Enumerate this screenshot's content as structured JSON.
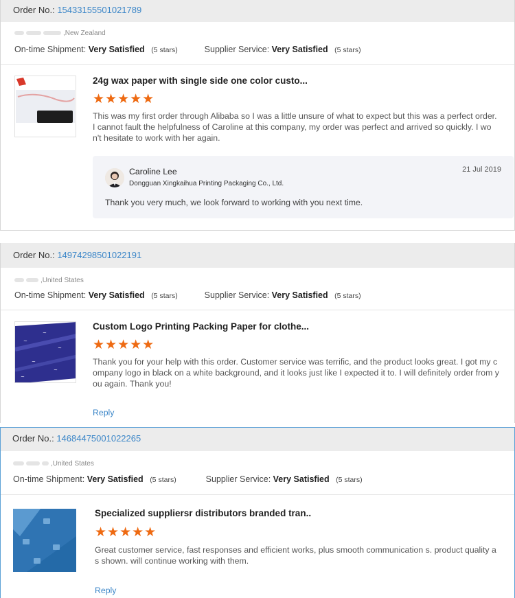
{
  "orders": [
    {
      "order_label": "Order No.:",
      "order_number": "15433155501021789",
      "buyer_location": ",New Zealand",
      "shipment_label": "On-time Shipment:",
      "shipment_value": "Very Satisfied",
      "shipment_stars": "(5 stars)",
      "service_label": "Supplier Service:",
      "service_value": "Very Satisfied",
      "service_stars": "(5 stars)",
      "product_title": "24g wax paper with single side one color custo...",
      "rating": 5,
      "stars_text": "★★★★★",
      "review_lines": [
        "This was my first order through Alibaba so I was a little unsure of what to expect but this was a perfect order.",
        "I cannot fault the helpfulness of Caroline at this company, my order was perfect and arrived so quickly. I wo",
        "n't hesitate to work with her again."
      ],
      "seller_reply": {
        "name": "Caroline Lee",
        "company": "Dongguan Xingkaihua Printing Packaging Co., Ltd.",
        "date": "21 Jul 2019",
        "text": "Thank you very much, we look forward to working with you next time."
      }
    },
    {
      "order_label": "Order No.:",
      "order_number": "14974298501022191",
      "buyer_location": ",United States",
      "shipment_label": "On-time Shipment:",
      "shipment_value": "Very Satisfied",
      "shipment_stars": "(5 stars)",
      "service_label": "Supplier Service:",
      "service_value": "Very Satisfied",
      "service_stars": "(5 stars)",
      "product_title": "Custom Logo Printing Packing Paper for clothe...",
      "rating": 5,
      "stars_text": "★★★★★",
      "review_lines": [
        "Thank you for your help with this order. Customer service was terrific, and the product looks great. I got my c",
        "ompany logo in black on a white background, and it looks just like I expected it to. I will definitely order from y",
        "ou again. Thank you!"
      ],
      "reply_label": "Reply"
    },
    {
      "order_label": "Order No.:",
      "order_number": "14684475001022265",
      "buyer_location": ",United States",
      "shipment_label": "On-time Shipment:",
      "shipment_value": "Very Satisfied",
      "shipment_stars": "(5 stars)",
      "service_label": "Supplier Service:",
      "service_value": "Very Satisfied",
      "service_stars": "(5 stars)",
      "product_title": "Specialized suppliersr distributors branded tran..",
      "rating": 5,
      "stars_text": "★★★★★",
      "review_lines": [
        "Great customer service, fast responses and efficient works, plus smooth communication s. product quality a",
        "s shown. will continue working with them."
      ],
      "reply_label": "Reply"
    }
  ],
  "colors": {
    "accent_link": "#3b86c8",
    "star": "#ee6a12",
    "order_bar_bg": "#ececec",
    "reply_box_bg": "#f3f4f8"
  }
}
